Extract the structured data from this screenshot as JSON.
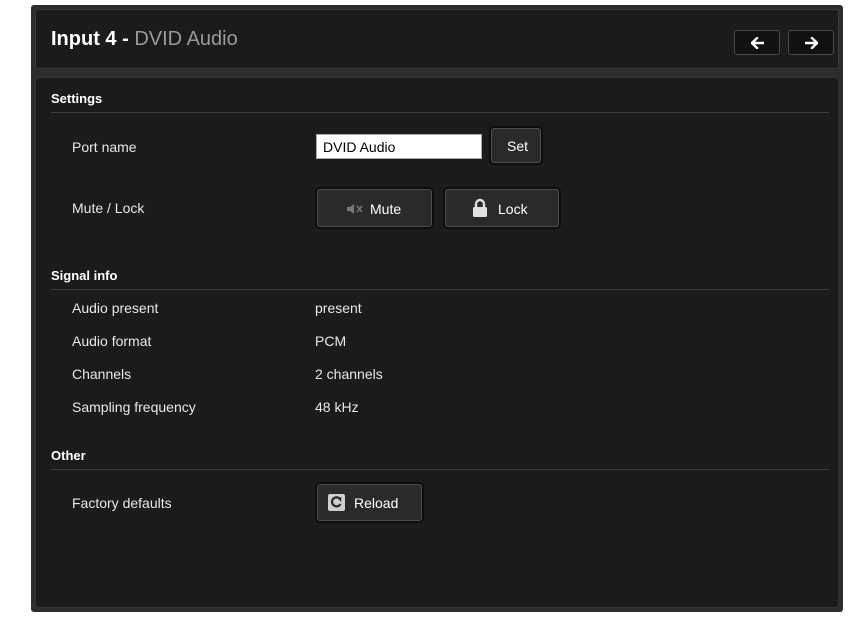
{
  "header": {
    "title": "Input 4 -",
    "subtitle": "DVID Audio",
    "prev_icon": "arrow-left-icon",
    "next_icon": "arrow-right-icon"
  },
  "settings": {
    "heading": "Settings",
    "port_name_label": "Port name",
    "port_name_value": "DVID Audio",
    "set_label": "Set",
    "mute_lock_label": "Mute / Lock",
    "mute_label": "Mute",
    "mute_icon": "speaker-muted-icon",
    "lock_label": "Lock",
    "lock_icon": "padlock-icon"
  },
  "signal_info": {
    "heading": "Signal info",
    "rows": [
      {
        "label": "Audio present",
        "value": "present"
      },
      {
        "label": "Audio format",
        "value": "PCM"
      },
      {
        "label": "Channels",
        "value": "2 channels"
      },
      {
        "label": "Sampling frequency",
        "value": "48 kHz"
      }
    ]
  },
  "other": {
    "heading": "Other",
    "factory_label": "Factory defaults",
    "reload_label": "Reload",
    "reload_icon": "reload-icon"
  },
  "colors": {
    "panel_bg": "#2d2d2d",
    "content_bg": "#1b1b1b",
    "subtitle": "#9a9a9a",
    "text": "#e8e8e8"
  }
}
